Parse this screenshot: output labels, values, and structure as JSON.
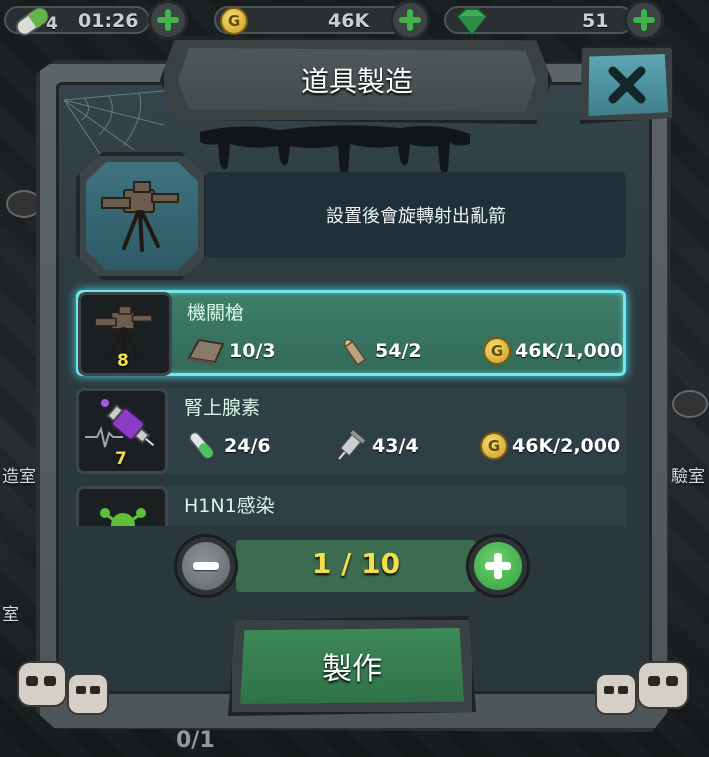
{
  "topbar": {
    "energy_count": "4",
    "timer": "01:26",
    "gold_amount": "46K",
    "gems_amount": "51"
  },
  "background": {
    "room_left_1": "造室",
    "room_left_2": "室",
    "room_right_1": "驗室"
  },
  "dialog": {
    "title": "道具製造",
    "description": "設置後會旋轉射出亂箭"
  },
  "items": [
    {
      "name": "機關槍",
      "level": "8",
      "stat1": "10/3",
      "stat2": "54/2",
      "gold": "46K/1,000",
      "selected": true
    },
    {
      "name": "腎上腺素",
      "level": "7",
      "stat1": "24/6",
      "stat2": "43/4",
      "gold": "46K/2,000",
      "selected": false
    },
    {
      "name": "H1N1感染",
      "selected": false
    }
  ],
  "quantity": {
    "value": "1 / 10"
  },
  "craft": {
    "label": "製作"
  },
  "bottom": {
    "count": "0/1"
  },
  "colors": {
    "accent_green": "#43b24a",
    "selected_glow": "#6fe7ef",
    "level_yellow": "#f3de4c",
    "close_teal": "#4f95a2"
  }
}
